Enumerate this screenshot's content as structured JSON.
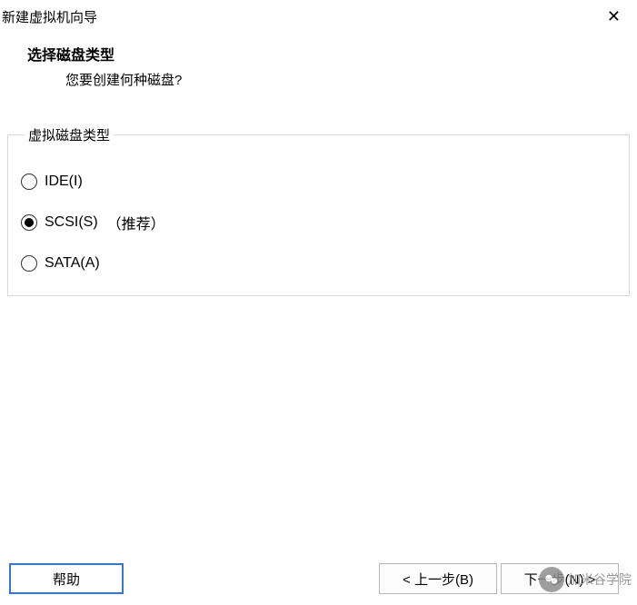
{
  "window": {
    "title": "新建虚拟机向导"
  },
  "header": {
    "title": "选择磁盘类型",
    "subtitle": "您要创建何种磁盘?"
  },
  "group": {
    "legend": "虚拟磁盘类型",
    "options": [
      {
        "label": "IDE(I)",
        "note": "",
        "selected": false
      },
      {
        "label": "SCSI(S)",
        "note": "（推荐）",
        "selected": true
      },
      {
        "label": "SATA(A)",
        "note": "",
        "selected": false
      }
    ]
  },
  "footer": {
    "help": "帮助",
    "back": "< 上一步(B)",
    "next": "下一步(N) >"
  },
  "watermark": {
    "text": "加米谷学院"
  }
}
